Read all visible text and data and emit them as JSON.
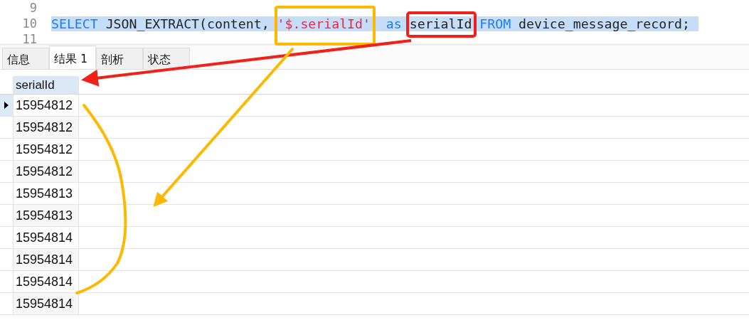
{
  "editor": {
    "lines": [
      {
        "number": "9"
      },
      {
        "number": "10",
        "selected": true,
        "tokens": [
          {
            "kind": "keyword",
            "text": "SELECT"
          },
          {
            "kind": "plain",
            "text": " JSON_EXTRACT(content, "
          },
          {
            "kind": "string",
            "text": "'$.serialId'"
          },
          {
            "kind": "keyword",
            "text": "  as"
          },
          {
            "kind": "plain",
            "text": " serialId "
          },
          {
            "kind": "keyword",
            "text": "FROM"
          },
          {
            "kind": "plain",
            "text": " device_message_record;"
          }
        ]
      },
      {
        "number": "11"
      }
    ]
  },
  "tabs": [
    {
      "label": "信息",
      "selected": false
    },
    {
      "label": "结果 1",
      "selected": true
    },
    {
      "label": "剖析",
      "selected": false
    },
    {
      "label": "状态",
      "selected": false
    }
  ],
  "table": {
    "columns": [
      "serialId"
    ],
    "rows": [
      {
        "cells": [
          "15954812"
        ],
        "selected": true
      },
      {
        "cells": [
          "15954812"
        ],
        "selected": false
      },
      {
        "cells": [
          "15954812"
        ],
        "selected": false
      },
      {
        "cells": [
          "15954812"
        ],
        "selected": false
      },
      {
        "cells": [
          "15954813"
        ],
        "selected": false
      },
      {
        "cells": [
          "15954813"
        ],
        "selected": false
      },
      {
        "cells": [
          "15954814"
        ],
        "selected": false
      },
      {
        "cells": [
          "15954814"
        ],
        "selected": false
      },
      {
        "cells": [
          "15954814"
        ],
        "selected": false
      },
      {
        "cells": [
          "15954814"
        ],
        "selected": false
      }
    ]
  }
}
